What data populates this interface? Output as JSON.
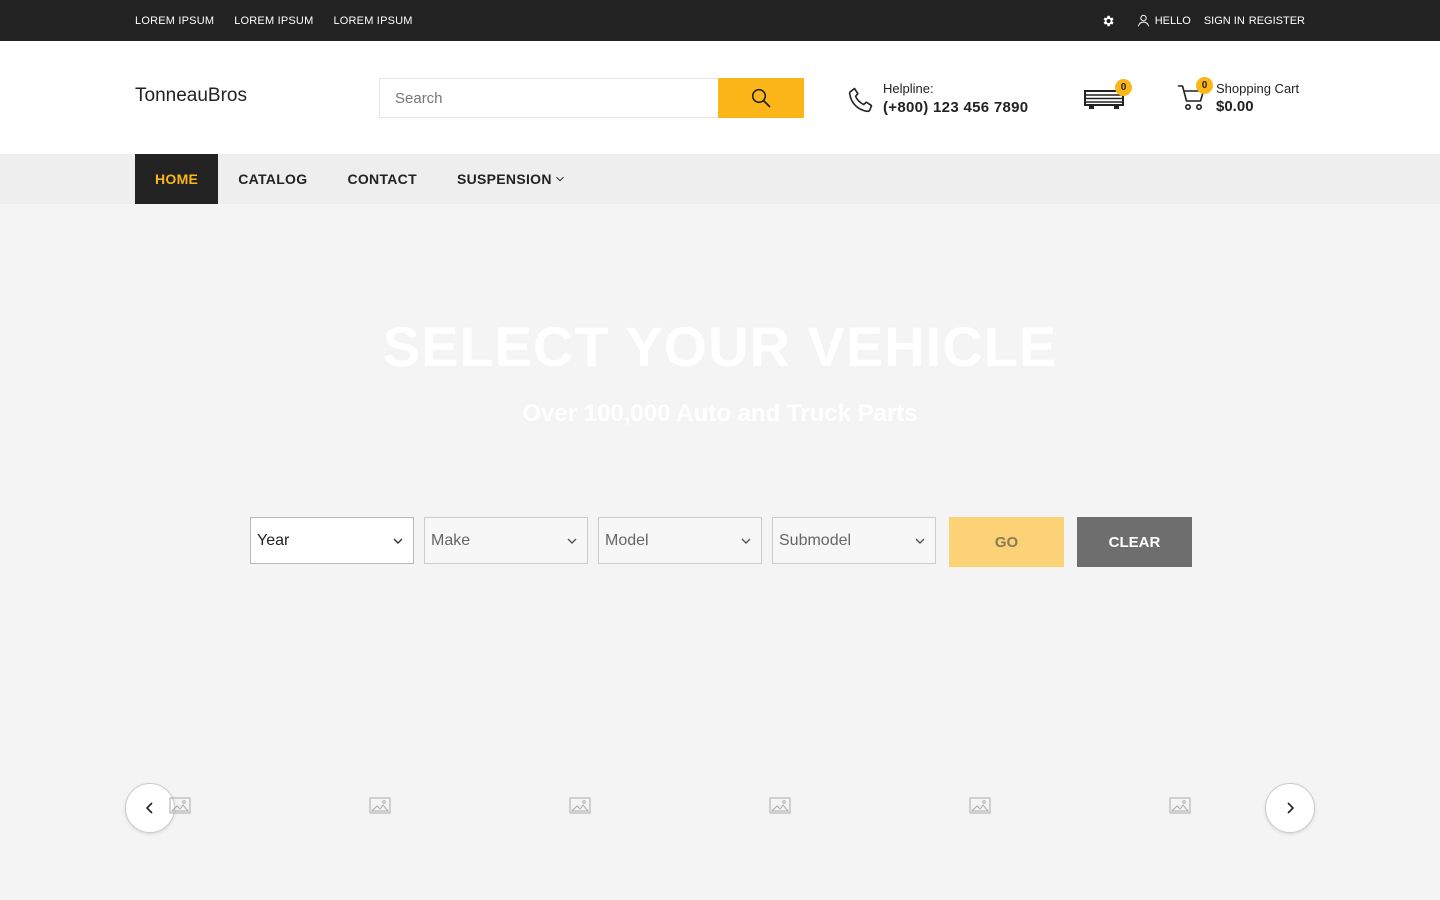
{
  "topbar": {
    "links": [
      "LOREM IPSUM",
      "LOREM IPSUM",
      "LOREM IPSUM"
    ],
    "greeting": "HELLO",
    "sign_in": "SIGN IN",
    "register": "REGISTER",
    "icons": [
      "gear-icon",
      "user-icon"
    ]
  },
  "header": {
    "logo": "TonneauBros",
    "search": {
      "placeholder": "Search",
      "value": ""
    },
    "helpline": {
      "label": "Helpline:",
      "number": "(+800) 123 456 7890"
    },
    "garage": {
      "count": "0"
    },
    "cart": {
      "count": "0",
      "label": "Shopping Cart",
      "amount": "$0.00"
    }
  },
  "nav": {
    "items": [
      {
        "label": "HOME",
        "active": true
      },
      {
        "label": "CATALOG"
      },
      {
        "label": "CONTACT"
      },
      {
        "label": "SUSPENSION",
        "has_dropdown": true
      }
    ]
  },
  "hero": {
    "title": "SELECT YOUR VEHICLE",
    "subtitle": "Over 100,000 Auto and Truck Parts",
    "selects": [
      {
        "label": "Year"
      },
      {
        "label": "Make"
      },
      {
        "label": "Model"
      },
      {
        "label": "Submodel"
      }
    ],
    "go_label": "GO",
    "clear_label": "CLEAR"
  },
  "colors": {
    "accent": "#fcb61a",
    "dark": "#222222",
    "clear_button": "#6e6e6e",
    "background": "#f4f4f4"
  }
}
